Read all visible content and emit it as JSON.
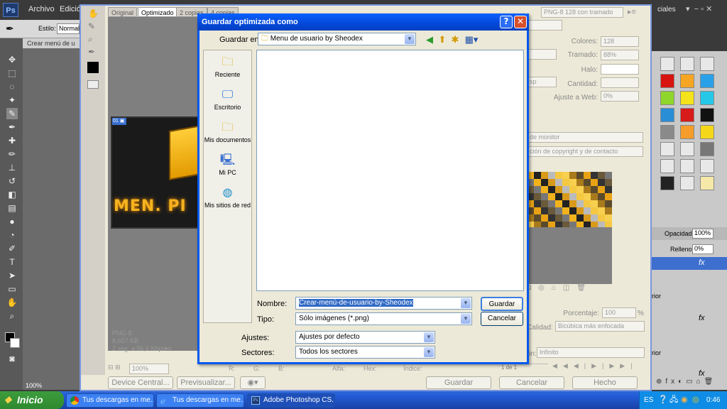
{
  "photoshop": {
    "logo": "Ps",
    "menu": [
      "Archivo",
      "Edición"
    ],
    "options": {
      "style_label": "Estilo:",
      "style_value": "Normal"
    },
    "doc_title": "Crear menú de u",
    "zoom": "100%",
    "right": {
      "panel_menu": "ciales",
      "opacity_label": "Opacidad:",
      "opacity_value": "100%",
      "fill_label": "Relleno:",
      "fill_value": "0%",
      "layer1": "rior",
      "layer2": "rior"
    }
  },
  "save_for_web": {
    "tabs": [
      "Original",
      "Optimizado",
      "2 copias",
      "4 copias"
    ],
    "preset_value": "PNG-8 128 con tramado",
    "settings": {
      "colors_label": "Colores:",
      "colors_value": "128",
      "dither_label": "Tramado:",
      "dither_value": "88%",
      "matte_label": "Halo:",
      "amount_label": "Cantidad:",
      "websnap_label": "Ajuste a Web:",
      "websnap_value": "0%",
      "sp_value": "sp",
      "monitor_text": "de monitor",
      "copyright_text": "ción de copyright y de contacto"
    },
    "image_info": {
      "format": "PNG-8",
      "size": "8,657 KB",
      "time": "2 seg. a 56,6 Kbps"
    },
    "image_caption": "MEN. PI",
    "size": {
      "percent_label": "Porcentaje:",
      "percent_value": "100",
      "percent_unit": "%",
      "quality_label": "Calidad:",
      "quality_value": "Bicúbica más enfocada"
    },
    "loop": {
      "label": "ón:",
      "value": "Infinito"
    },
    "frame_counter": "1 de 1",
    "status": {
      "zoom": "100%",
      "r": "R:",
      "g": "G:",
      "b": "B:",
      "alpha": "Alfa:",
      "hex": "Hex:",
      "index": "Índice:"
    },
    "buttons": {
      "device_central": "Device Central...",
      "preview": "Previsualizar...",
      "save": "Guardar",
      "cancel": "Cancelar",
      "done": "Hecho"
    }
  },
  "dialog": {
    "title": "Guardar optimizada como",
    "save_in_label": "Guardar en:",
    "save_in_value": "Menu de usuario by Sheodex",
    "places": [
      "Reciente",
      "Escritorio",
      "Mis documentos",
      "Mi PC",
      "Mis sitios de red"
    ],
    "name_label": "Nombre:",
    "name_value": "Crear-menú-de-usuario-by-Sheodex",
    "type_label": "Tipo:",
    "type_value": "Sólo imágenes (*.png)",
    "settings_label": "Ajustes:",
    "settings_value": "Ajustes por defecto",
    "slices_label": "Sectores:",
    "slices_value": "Todos los sectores",
    "save_button": "Guardar",
    "cancel_button": "Cancelar"
  },
  "taskbar": {
    "start": "Inicio",
    "tasks": [
      "Tus descargas en me...",
      "Tus descargas en me...",
      "Adobe Photoshop CS..."
    ],
    "lang": "ES",
    "clock": "0:46"
  }
}
